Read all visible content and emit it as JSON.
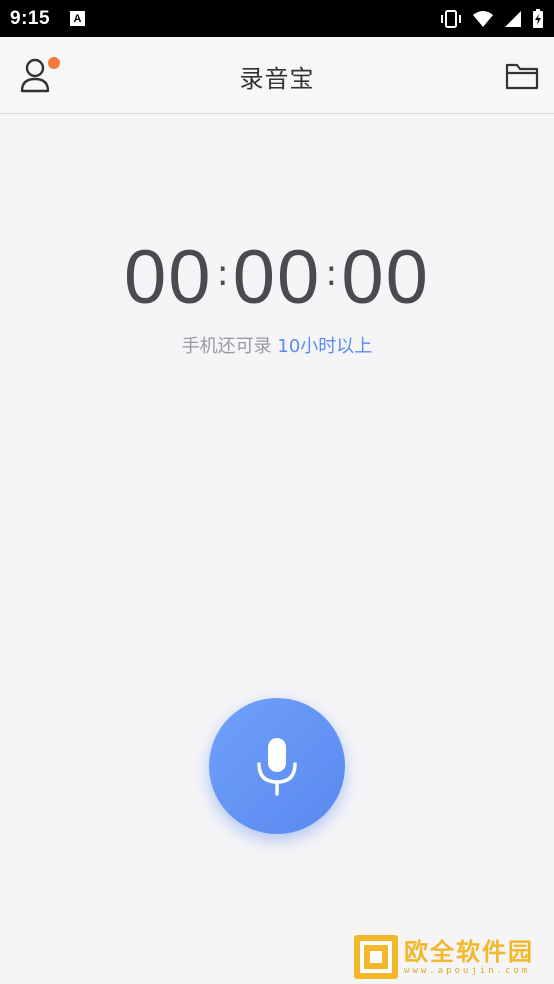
{
  "status_bar": {
    "time": "9:15",
    "notification_badge": "A",
    "icons": [
      "vibrate-icon",
      "wifi-icon",
      "signal-icon",
      "battery-charging-icon"
    ]
  },
  "header": {
    "title": "录音宝",
    "left_icon": "user-icon",
    "right_icon": "folder-icon",
    "notification_dot_color": "#f47b3c"
  },
  "timer": {
    "hours": "00",
    "minutes": "00",
    "seconds": "00",
    "separator": ":"
  },
  "remaining": {
    "prefix": "手机还可录",
    "highlight": "10小时以上",
    "highlight_color": "#5b8cf0"
  },
  "record_button": {
    "icon": "microphone-icon",
    "color": "#5f8ff2"
  },
  "watermark": {
    "name": "欧全软件园",
    "url": "www.apoujin.com",
    "color": "#f3b72a"
  }
}
